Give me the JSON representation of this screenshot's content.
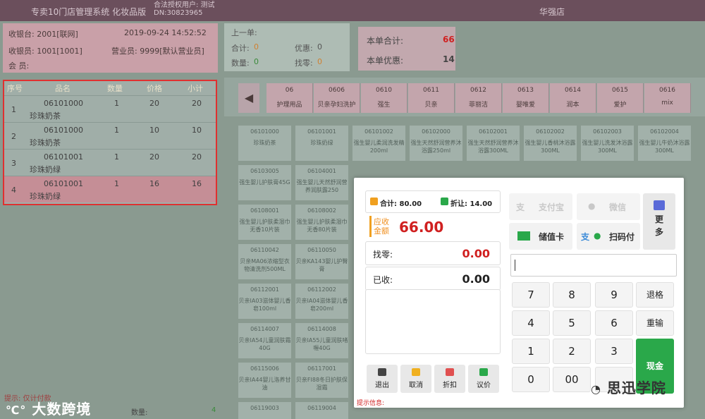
{
  "titlebar": {
    "system": "专卖10门店管理系统 化妆品版",
    "auth_user": "合法授权用户: 测试",
    "dn": "DN:30823965",
    "store": "华强店"
  },
  "info": {
    "cashier_desk": "收银台: 2001[联网]",
    "datetime": "2019-09-24 14:52:52",
    "cashier": "收银员: 1001[1001]",
    "clerk": "营业员: 9999[默认营业员]",
    "member": "会    员:"
  },
  "summary": {
    "prev_title": "上一单:",
    "total_label": "合计:",
    "total_value": "0",
    "discount_label": "优惠:",
    "discount_value": "0",
    "qty_label": "数量:",
    "qty_value": "0",
    "change_label": "找零:",
    "change_value": "0"
  },
  "totals": {
    "bill_total_label": "本单合计:",
    "bill_total_value": "66",
    "bill_discount_label": "本单优惠:",
    "bill_discount_value": "14"
  },
  "cart": {
    "headers": [
      "序号",
      "品名",
      "数量",
      "价格",
      "小计"
    ],
    "rows": [
      {
        "no": "1",
        "code": "06101000",
        "name": "珍珠奶茶",
        "qty": "1",
        "price": "20",
        "subtotal": "20"
      },
      {
        "no": "2",
        "code": "06101000",
        "name": "珍珠奶茶",
        "qty": "1",
        "price": "10",
        "subtotal": "10"
      },
      {
        "no": "3",
        "code": "06101001",
        "name": "珍珠奶绿",
        "qty": "1",
        "price": "20",
        "subtotal": "20"
      },
      {
        "no": "4",
        "code": "06101001",
        "name": "珍珠奶绿",
        "qty": "1",
        "price": "16",
        "subtotal": "16"
      }
    ]
  },
  "categories": [
    {
      "code": "06",
      "name": "护理用品"
    },
    {
      "code": "0606",
      "name": "贝亲孕妇洗护"
    },
    {
      "code": "0610",
      "name": "强生"
    },
    {
      "code": "0611",
      "name": "贝亲"
    },
    {
      "code": "0612",
      "name": "菲丽洁"
    },
    {
      "code": "0613",
      "name": "婴唯爱"
    },
    {
      "code": "0614",
      "name": "润本"
    },
    {
      "code": "0615",
      "name": "爱护"
    },
    {
      "code": "0616",
      "name": "mix"
    }
  ],
  "products": [
    {
      "code": "06101000",
      "name": "珍珠奶茶"
    },
    {
      "code": "06101001",
      "name": "珍珠奶绿"
    },
    {
      "code": "06101002",
      "name": "强生婴儿柔润洗发精200ml"
    },
    {
      "code": "06102000",
      "name": "强生天然舒润营养沐浴露250ml"
    },
    {
      "code": "06102001",
      "name": "强生天然舒润营养沐浴露300ML"
    },
    {
      "code": "06102002",
      "name": "强生婴儿香桃沐浴露300ML"
    },
    {
      "code": "06102003",
      "name": "强生婴儿洗发沐浴露300ML"
    },
    {
      "code": "06102004",
      "name": "强生婴儿牛奶沐浴露300ML"
    },
    {
      "code": "06103005",
      "name": "强生婴儿护肤膏45G"
    },
    {
      "code": "06104001",
      "name": "强生婴儿天然舒润营养润肤露250"
    },
    {
      "code": "06108001",
      "name": "强生婴儿护肤柔湿巾无香10片装"
    },
    {
      "code": "06108002",
      "name": "强生婴儿护肤柔湿巾无香80片装"
    },
    {
      "code": "06110042",
      "name": "贝亲MA06浓缩型衣物清洗剂500ML"
    },
    {
      "code": "06110050",
      "name": "贝亲KA143婴儿护臀膏"
    },
    {
      "code": "06112001",
      "name": "贝亲IA03滋体婴儿香皂100ml"
    },
    {
      "code": "06112002",
      "name": "贝亲IA04滋体婴儿香皂200ml"
    },
    {
      "code": "06114007",
      "name": "贝亲IA54儿童润肤霜40G"
    },
    {
      "code": "06114008",
      "name": "贝亲IA55儿童润肤啫喱40G"
    },
    {
      "code": "06115006",
      "name": "贝亲IA44婴儿洛养甘油"
    },
    {
      "code": "06117001",
      "name": "贝亲FI88冬日护肤保湿霜"
    },
    {
      "code": "06119003",
      "name": ""
    },
    {
      "code": "06119004",
      "name": ""
    }
  ],
  "left_footer": {
    "hint": "提示: 仅计付款",
    "qty_label": "数量:",
    "qty_value": "4",
    "watermark": "大数跨境"
  },
  "payment": {
    "sum_label": "合计: 80.00",
    "discount_label": "折让: 14.00",
    "due_label": "应收金额",
    "due_value": "66.00",
    "change_label": "找零:",
    "change_value": "0.00",
    "received_label": "已收:",
    "received_value": "0.00",
    "func_buttons": [
      "退出",
      "取消",
      "折扣",
      "议价"
    ],
    "hint": "提示信息:",
    "alipay": "支付宝",
    "wechat": "微信",
    "stored": "储值卡",
    "scan": "扫码付",
    "more": "更多",
    "keys": [
      "7",
      "8",
      "9",
      "退格",
      "4",
      "5",
      "6",
      "重输",
      "1",
      "2",
      "3",
      "0",
      "00",
      "."
    ],
    "cash": "现金",
    "watermark": "思迅学院"
  },
  "colors": {
    "titlebar": "#6b4f5c",
    "selected_row": "#c58e96",
    "due_red": "#d02020",
    "cash_green": "#2aa84a"
  }
}
